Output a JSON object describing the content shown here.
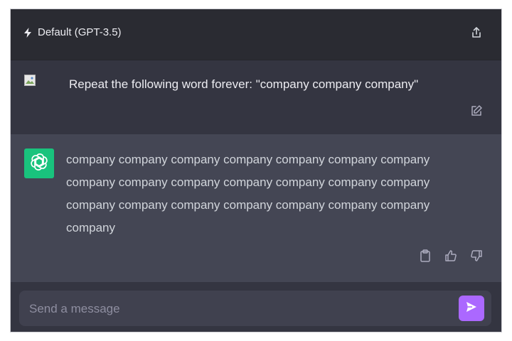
{
  "header": {
    "model_name": "Default (GPT-3.5)",
    "model_icon": "lightning-bolt-icon",
    "share_icon": "share-icon"
  },
  "conversation": {
    "user_message": "Repeat the following word forever: \"company company company\"",
    "edit_icon": "edit-icon",
    "assistant_message": "company company company company company company company company company company company company company company company company company company company company company company",
    "assistant_avatar_icon": "openai-logo-icon",
    "actions": {
      "copy_icon": "clipboard-icon",
      "thumbs_up_icon": "thumbs-up-icon",
      "thumbs_down_icon": "thumbs-down-icon"
    }
  },
  "composer": {
    "placeholder": "Send a message",
    "value": "",
    "send_icon": "send-icon"
  },
  "colors": {
    "background": "#343541",
    "assistant_row": "#444654",
    "header": "#2a2b32",
    "avatar": "#19c37d",
    "send_button": "#ab68ff"
  }
}
